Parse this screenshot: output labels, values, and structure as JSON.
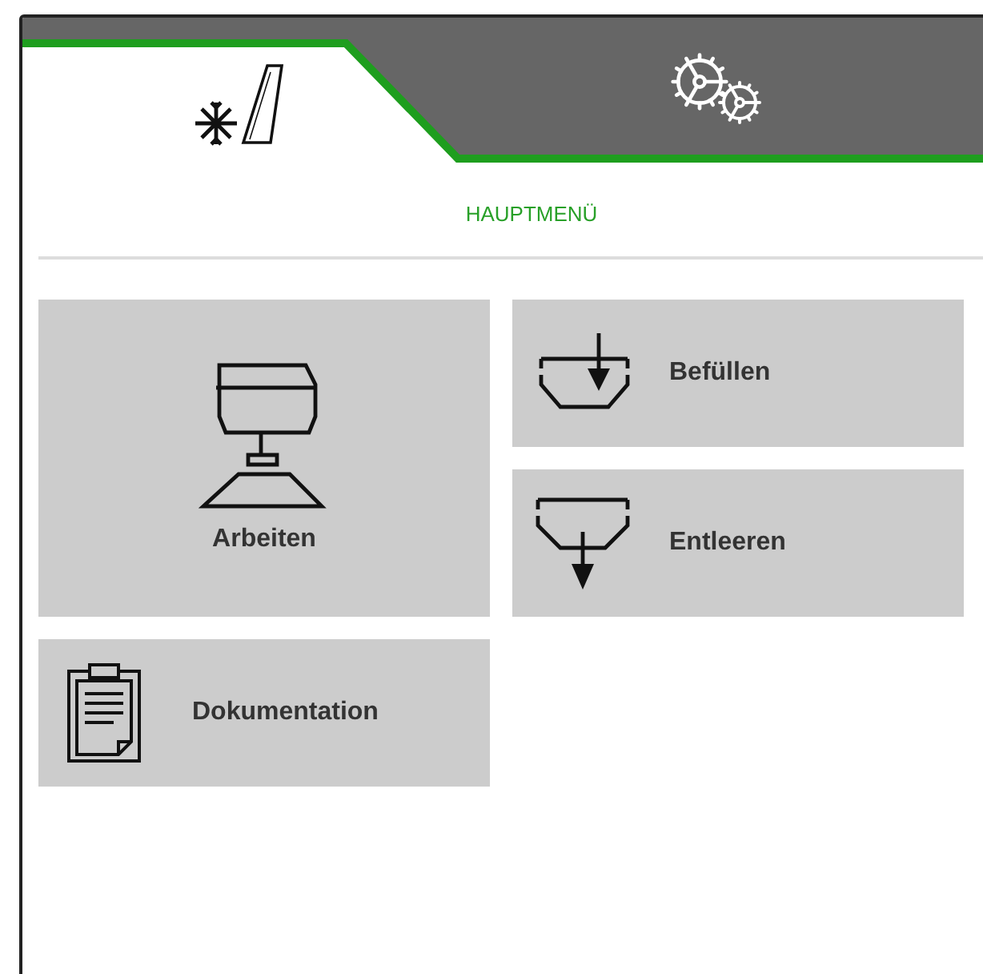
{
  "tabs": [
    {
      "kind": "winter",
      "selected": true
    },
    {
      "kind": "settings",
      "selected": false
    }
  ],
  "title": "HAUPTMENÜ",
  "tiles": [
    {
      "kind": "work",
      "label": "Arbeiten"
    },
    {
      "kind": "fill",
      "label": "Befüllen"
    },
    {
      "kind": "empty",
      "label": "Entleeren"
    },
    {
      "kind": "docs",
      "label": "Dokumentation"
    }
  ]
}
